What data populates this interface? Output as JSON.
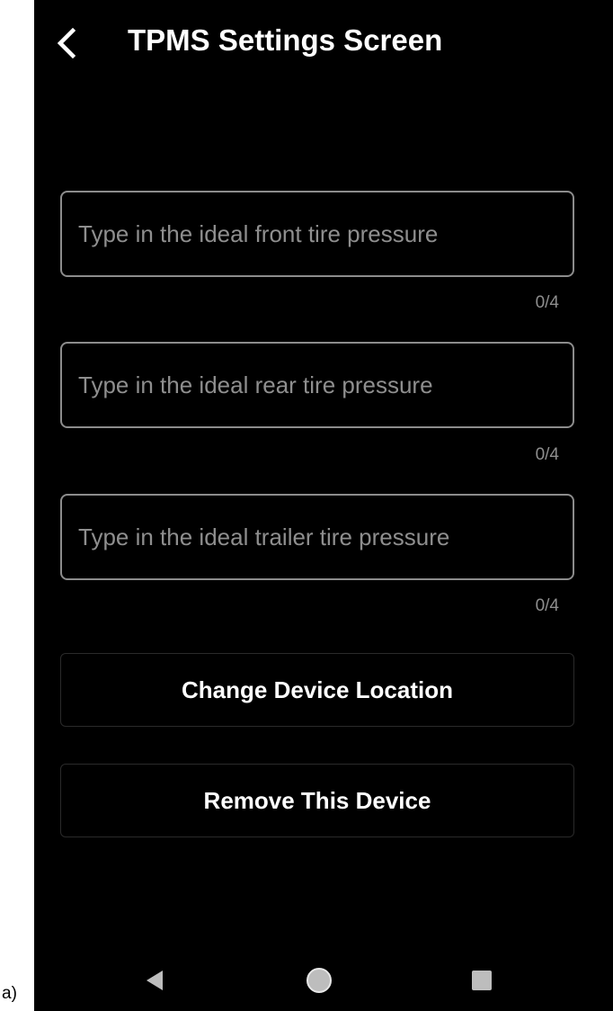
{
  "figure_label": "a)",
  "app_bar": {
    "title": "TPMS Settings Screen",
    "back_icon": "chevron-left-icon"
  },
  "fields": [
    {
      "placeholder": "Type in the ideal front tire pressure",
      "value": "",
      "counter": "0/4"
    },
    {
      "placeholder": "Type in the ideal rear tire pressure",
      "value": "",
      "counter": "0/4"
    },
    {
      "placeholder": "Type in the ideal trailer tire pressure",
      "value": "",
      "counter": "0/4"
    }
  ],
  "buttons": {
    "change_location": "Change Device Location",
    "remove_device": "Remove This Device"
  },
  "nav": {
    "back_icon": "triangle-back-icon",
    "home_icon": "circle-home-icon",
    "recents_icon": "square-recents-icon"
  },
  "colors": {
    "background": "#000000",
    "text": "#ffffff",
    "placeholder": "#8e8e8e",
    "field_border": "#8c8c8c",
    "button_border": "#2a2a2a"
  }
}
